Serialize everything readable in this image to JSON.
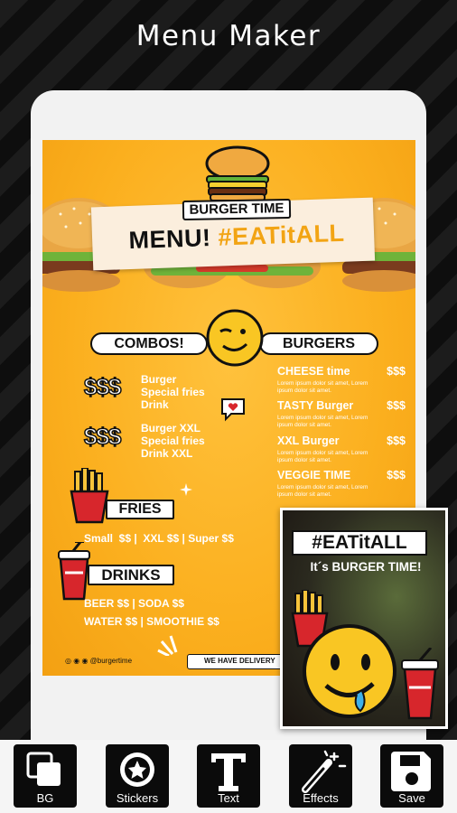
{
  "app": {
    "title": "Menu Maker"
  },
  "menu": {
    "banner_sub": "BURGER TIME",
    "banner_title": "MENU!",
    "banner_hashtag": "#EATitALL",
    "combos_label": "COMBOS!",
    "burgers_label": "BURGERS",
    "combos": [
      {
        "price": "$$$",
        "items": [
          "Burger",
          "Special fries",
          "Drink"
        ]
      },
      {
        "price": "$$$",
        "items": [
          "Burger XXL",
          "Special fries",
          "Drink XXL"
        ]
      }
    ],
    "burgers": [
      {
        "name": "CHEESE time",
        "price": "$$$",
        "desc": "Lorem ipsum dolor sit amet, Lorem ipsum dolor sit amet."
      },
      {
        "name": "TASTY Burger",
        "price": "$$$",
        "desc": "Lorem ipsum dolor sit amet, Lorem ipsum dolor sit amet."
      },
      {
        "name": "XXL Burger",
        "price": "$$$",
        "desc": "Lorem ipsum dolor sit amet, Lorem ipsum dolor sit amet."
      },
      {
        "name": "VEGGIE TIME",
        "price": "$$$",
        "desc": "Lorem ipsum dolor sit amet, Lorem ipsum dolor sit amet."
      }
    ],
    "fries_label": "FRIES",
    "fries_prices": "Small  $$ |  XXL $$ | Super $$",
    "drinks_label": "DRINKS",
    "drinks_line1": "BEER $$ | SODA $$",
    "drinks_line2": "WATER $$ | SMOOTHIE $$",
    "social_handle": "@burgertime",
    "delivery": "WE HAVE DELIVERY"
  },
  "sticker": {
    "hashtag": "#EATitALL",
    "subtitle": "It´s BURGER TIME!"
  },
  "toolbar": {
    "bg": "BG",
    "stickers": "Stickers",
    "text": "Text",
    "effects": "Effects",
    "save": "Save"
  },
  "colors": {
    "menu_yellow": "#fbaf1e",
    "hashtag_accent": "#f2a414",
    "toolbar_button": "#0b0b0b"
  }
}
